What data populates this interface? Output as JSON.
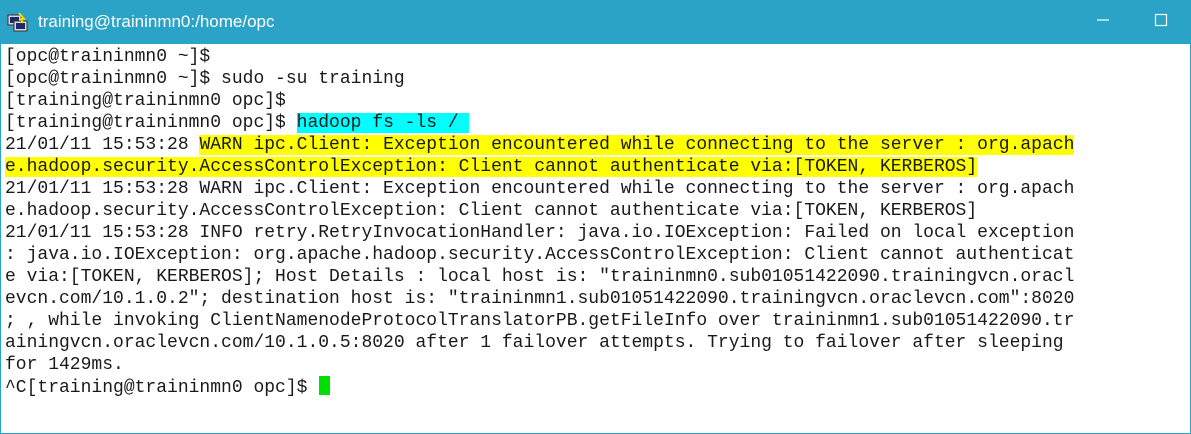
{
  "window": {
    "title": "training@traininmn0:/home/opc"
  },
  "icons": {
    "app": "putty-icon",
    "minimize": "minimize-icon",
    "maximize": "maximize-icon",
    "colors": {
      "titlebar": "#2ba3c6",
      "highlight_yellow": "#ffff00",
      "highlight_cyan": "#00ffff",
      "cursor": "#00e000"
    }
  },
  "terminal": {
    "l1": "[opc@traininmn0 ~]$",
    "l2": "[opc@traininmn0 ~]$ sudo -su training",
    "l3": "[training@traininmn0 opc]$",
    "l4_prompt": "[training@traininmn0 opc]$ ",
    "l4_cmd": "hadoop fs -ls / ",
    "l5_prefix": "21/01/11 15:53:28 ",
    "l5_hl": "WARN ipc.Client: Exception encountered while connecting to the server : org.apach",
    "l6": "e.hadoop.security.AccessControlException: Client cannot authenticate via:[TOKEN, KERBEROS]",
    "l7": "21/01/11 15:53:28 WARN ipc.Client: Exception encountered while connecting to the server : org.apach",
    "l8": "e.hadoop.security.AccessControlException: Client cannot authenticate via:[TOKEN, KERBEROS]",
    "l9": "21/01/11 15:53:28 INFO retry.RetryInvocationHandler: java.io.IOException: Failed on local exception",
    "l10": ": java.io.IOException: org.apache.hadoop.security.AccessControlException: Client cannot authenticat",
    "l11": "e via:[TOKEN, KERBEROS]; Host Details : local host is: \"traininmn0.sub01051422090.trainingvcn.oracl",
    "l12": "evcn.com/10.1.0.2\"; destination host is: \"traininmn1.sub01051422090.trainingvcn.oraclevcn.com\":8020",
    "l13": "; , while invoking ClientNamenodeProtocolTranslatorPB.getFileInfo over traininmn1.sub01051422090.tr",
    "l14": "ainingvcn.oraclevcn.com/10.1.0.5:8020 after 1 failover attempts. Trying to failover after sleeping",
    "l15": "for 1429ms.",
    "l16": "^C[training@traininmn0 opc]$ "
  }
}
